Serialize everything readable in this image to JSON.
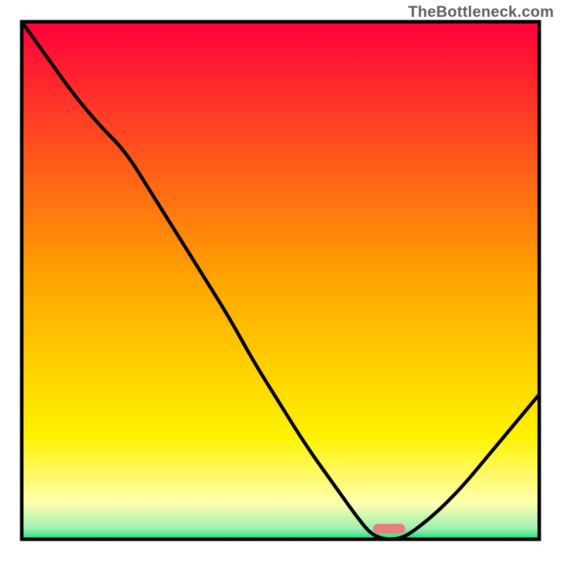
{
  "attribution": "TheBottleneck.com",
  "chart_data": {
    "type": "line",
    "title": "",
    "xlabel": "",
    "ylabel": "",
    "x": [
      0.0,
      0.05,
      0.1,
      0.15,
      0.2,
      0.25,
      0.3,
      0.35,
      0.4,
      0.45,
      0.5,
      0.55,
      0.6,
      0.65,
      0.675,
      0.7,
      0.725,
      0.75,
      0.8,
      0.85,
      0.9,
      0.95,
      1.0
    ],
    "values": [
      100,
      93,
      86,
      80,
      75,
      67,
      59,
      51,
      43,
      34,
      26,
      18,
      11,
      4,
      1,
      0,
      0,
      1,
      5,
      10,
      16,
      22,
      28
    ],
    "xlim": [
      0,
      1
    ],
    "ylim": [
      0,
      100
    ],
    "marker": {
      "x": 0.71,
      "y": 0,
      "color": "#E58080"
    },
    "background_gradient": {
      "stops": [
        {
          "offset": 0.0,
          "color": "#FF003A"
        },
        {
          "offset": 0.5,
          "color": "#FFA500"
        },
        {
          "offset": 0.8,
          "color": "#FFF200"
        },
        {
          "offset": 0.93,
          "color": "#FFFFB0"
        },
        {
          "offset": 0.98,
          "color": "#9BEFB0"
        },
        {
          "offset": 1.0,
          "color": "#14E07A"
        }
      ]
    }
  }
}
